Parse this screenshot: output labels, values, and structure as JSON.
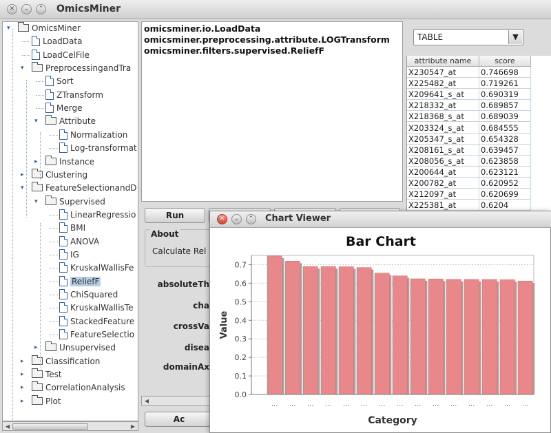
{
  "app": {
    "title": "OmicsMiner"
  },
  "tree": {
    "nodes": [
      {
        "label": "OmicsMiner",
        "type": "folder",
        "level": 0,
        "toggle": "open"
      },
      {
        "label": "LoadData",
        "type": "file",
        "level": 1
      },
      {
        "label": "LoadCelFile",
        "type": "file",
        "level": 1
      },
      {
        "label": "PreprocessingandTra",
        "type": "folder",
        "level": 1,
        "toggle": "open"
      },
      {
        "label": "Sort",
        "type": "file",
        "level": 2
      },
      {
        "label": "ZTransform",
        "type": "file",
        "level": 2
      },
      {
        "label": "Merge",
        "type": "file",
        "level": 2
      },
      {
        "label": "Attribute",
        "type": "folder",
        "level": 2,
        "toggle": "open"
      },
      {
        "label": "Normalization",
        "type": "file",
        "level": 3
      },
      {
        "label": "Log-transformat",
        "type": "file",
        "level": 3
      },
      {
        "label": "Instance",
        "type": "folder",
        "level": 2,
        "toggle": "closed"
      },
      {
        "label": "Clustering",
        "type": "folder",
        "level": 1,
        "toggle": "closed"
      },
      {
        "label": "FeatureSelectionandD",
        "type": "folder",
        "level": 1,
        "toggle": "open"
      },
      {
        "label": "Supervised",
        "type": "folder",
        "level": 2,
        "toggle": "open"
      },
      {
        "label": "LinearRegressio",
        "type": "file",
        "level": 3
      },
      {
        "label": "BMI",
        "type": "file",
        "level": 3
      },
      {
        "label": "ANOVA",
        "type": "file",
        "level": 3
      },
      {
        "label": "IG",
        "type": "file",
        "level": 3
      },
      {
        "label": "KruskalWallisFe",
        "type": "file",
        "level": 3
      },
      {
        "label": "ReliefF",
        "type": "file",
        "level": 3,
        "selected": true
      },
      {
        "label": "ChiSquared",
        "type": "file",
        "level": 3
      },
      {
        "label": "KruskalWallisTe",
        "type": "file",
        "level": 3
      },
      {
        "label": "StackedFeature",
        "type": "file",
        "level": 3
      },
      {
        "label": "FeatureSelectio",
        "type": "file",
        "level": 3
      },
      {
        "label": "Unsupervised",
        "type": "folder",
        "level": 2,
        "toggle": "closed"
      },
      {
        "label": "Classification",
        "type": "folder",
        "level": 1,
        "toggle": "closed"
      },
      {
        "label": "Test",
        "type": "folder",
        "level": 1,
        "toggle": "closed"
      },
      {
        "label": "CorrelationAnalysis",
        "type": "folder",
        "level": 1,
        "toggle": "closed"
      },
      {
        "label": "Plot",
        "type": "folder",
        "level": 1,
        "toggle": "closed"
      }
    ]
  },
  "log": {
    "lines": [
      "omicsminer.io.LoadData",
      "omicsminer.preprocessing.attribute.LOGTransform",
      "omicsminer.filters.supervised.ReliefF"
    ]
  },
  "toolbar": {
    "run_label": "Run"
  },
  "about": {
    "title": "About",
    "text": "Calculate Rel"
  },
  "params": [
    "absoluteTh",
    "cha",
    "crossVa",
    "disea",
    "domainAx"
  ],
  "add_button": {
    "label": "Ac"
  },
  "view_select": {
    "value": "TABLE"
  },
  "table": {
    "headers": [
      "attribute name",
      "score"
    ],
    "rows": [
      [
        "X230547_at",
        "0.746698"
      ],
      [
        "X225482_at",
        "0.719261"
      ],
      [
        "X209641_s_at",
        "0.690319"
      ],
      [
        "X218332_at",
        "0.689857"
      ],
      [
        "X218368_s_at",
        "0.689039"
      ],
      [
        "X203324_s_at",
        "0.684555"
      ],
      [
        "X205347_s_at",
        "0.654328"
      ],
      [
        "X208161_s_at",
        "0.639457"
      ],
      [
        "X208056_s_at",
        "0.623858"
      ],
      [
        "X200644_at",
        "0.623121"
      ],
      [
        "X200782_at",
        "0.620952"
      ],
      [
        "X212097_at",
        "0.620699"
      ],
      [
        "X225381_at",
        "0.6204"
      ]
    ]
  },
  "chart_window": {
    "title": "Chart Viewer"
  },
  "colors": {
    "bar": "#e8888a",
    "bar_shadow": "#a3a3a3",
    "selection": "#b8cfe5"
  },
  "chart_data": {
    "type": "bar",
    "title": "Bar Chart",
    "xlabel": "Category",
    "ylabel": "Value",
    "ylim": [
      0,
      0.75
    ],
    "yticks": [
      "0.0",
      "0.1",
      "0.2",
      "0.3",
      "0.4",
      "0.5",
      "0.6",
      "0.7"
    ],
    "categories": [
      "...",
      "...",
      "...",
      "...",
      "...",
      "...",
      "...",
      "...",
      "...",
      "...",
      "...",
      "...",
      "...",
      "...",
      "..."
    ],
    "values": [
      0.746698,
      0.719261,
      0.690319,
      0.689857,
      0.689039,
      0.684555,
      0.654328,
      0.639457,
      0.623858,
      0.623121,
      0.620952,
      0.620699,
      0.6204,
      0.6195,
      0.612
    ],
    "grid": true
  }
}
